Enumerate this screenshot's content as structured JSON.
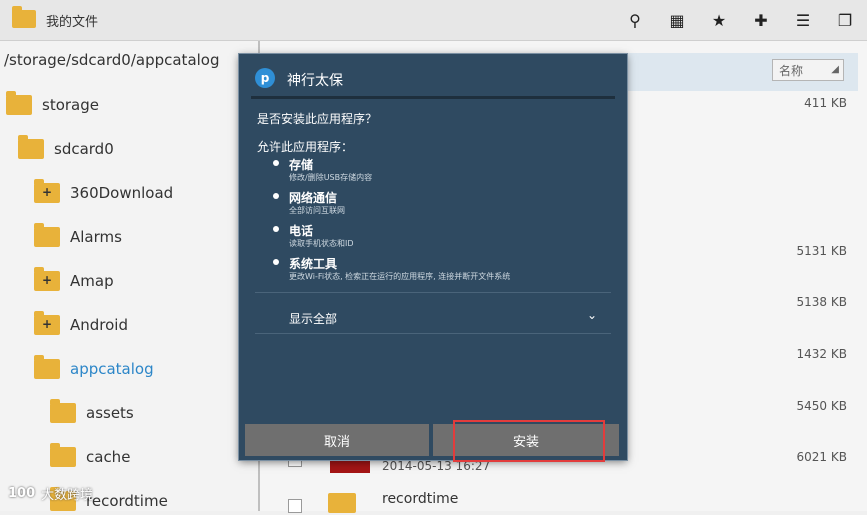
{
  "topbar": {
    "title": "我的文件",
    "icons": [
      "search-icon",
      "grid-view-icon",
      "folder-star-icon",
      "add-folder-icon",
      "sort-menu-icon",
      "window-icon"
    ]
  },
  "left_panel": {
    "path": "/storage/sdcard0/appcatalog",
    "items": [
      {
        "label": "storage",
        "has_plus": false,
        "active": false
      },
      {
        "label": "sdcard0",
        "has_plus": false,
        "active": false
      },
      {
        "label": "360Download",
        "has_plus": true,
        "active": false
      },
      {
        "label": "Alarms",
        "has_plus": false,
        "active": false
      },
      {
        "label": "Amap",
        "has_plus": true,
        "active": false
      },
      {
        "label": "Android",
        "has_plus": true,
        "active": false
      },
      {
        "label": "appcatalog",
        "has_plus": false,
        "active": true
      },
      {
        "label": "assets",
        "has_plus": false,
        "active": false
      },
      {
        "label": "cache",
        "has_plus": false,
        "active": false
      },
      {
        "label": "recordtime",
        "has_plus": false,
        "active": false
      }
    ]
  },
  "right_panel": {
    "sort_label": "名称",
    "sizes": [
      "411 KB",
      "5131 KB",
      "5138 KB",
      "1432 KB",
      "5450 KB",
      "6021 KB"
    ],
    "last_date": "2014-05-13 16:27",
    "last_name": "recordtime"
  },
  "dialog": {
    "title": "神行太保",
    "question": "是否安装此应用程序？",
    "allow_label": "允许此应用程序：",
    "permissions": [
      {
        "title": "存储",
        "desc": "修改/删除USB存储内容"
      },
      {
        "title": "网络通信",
        "desc": "全部访问互联网"
      },
      {
        "title": "电话",
        "desc": "读取手机状态和ID"
      },
      {
        "title": "系统工具",
        "desc": "更改Wi-Fi状态, 检索正在运行的应用程序, 连接并断开文件系统"
      }
    ],
    "show_all": "显示全部",
    "cancel_label": "取消",
    "install_label": "安装"
  },
  "watermark": {
    "logo": "100",
    "text": "大数跨境"
  }
}
